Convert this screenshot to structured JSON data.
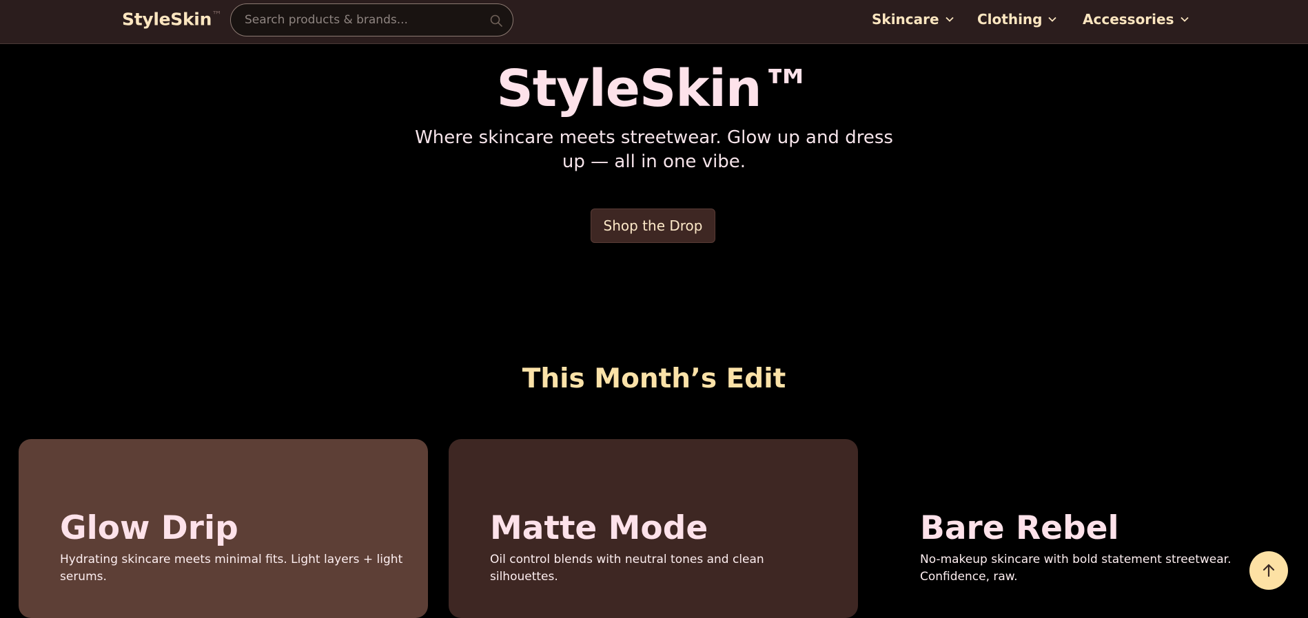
{
  "header": {
    "logo": "StyleSkin",
    "logo_mark": "™",
    "search_placeholder": "Search products & brands...",
    "nav": [
      {
        "label": "Skincare"
      },
      {
        "label": "Clothing"
      },
      {
        "label": "Accessories"
      }
    ]
  },
  "hero": {
    "title": "StyleSkin™",
    "subtitle": "Where skincare meets streetwear. Glow up and dress up — all in one vibe.",
    "cta_label": "Shop the Drop"
  },
  "edit": {
    "title": "This Month’s Edit",
    "cards": [
      {
        "title": "Glow Drip",
        "text": "Hydrating skincare meets minimal fits. Light layers + light serums.",
        "color": "#5d3f36"
      },
      {
        "title": "Matte Mode",
        "text": "Oil control blends with neutral tones and clean silhouettes.",
        "color": "#3e2723"
      },
      {
        "title": "Bare Rebel",
        "text": "No-makeup skincare with bold statement streetwear. Confidence, raw.",
        "color": "transparent"
      }
    ]
  },
  "icons": {
    "search": "search-icon",
    "chevron": "chevron-down-icon",
    "back_to_top": "arrow-up-icon"
  },
  "colors": {
    "header_bg": "#2b1d1d",
    "accent": "#fce6c0",
    "hero_text": "#fde2ea",
    "section_title": "#fbe2a8",
    "to_top_bg": "#fde1a4"
  }
}
